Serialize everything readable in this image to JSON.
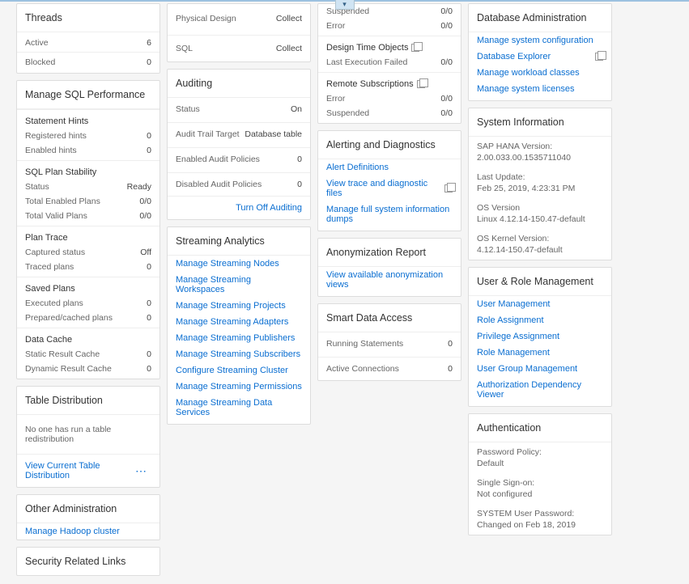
{
  "threads": {
    "title": "Threads",
    "active_l": "Active",
    "active_v": "6",
    "blocked_l": "Blocked",
    "blocked_v": "0"
  },
  "sqlperf": {
    "title": "Manage SQL Performance",
    "hints_title": "Statement Hints",
    "reghints_l": "Registered hints",
    "reghints_v": "0",
    "enabhints_l": "Enabled hints",
    "enabhints_v": "0",
    "plan_title": "SQL Plan Stability",
    "status_l": "Status",
    "status_v": "Ready",
    "enabplans_l": "Total Enabled Plans",
    "enabplans_v": "0/0",
    "validplans_l": "Total Valid Plans",
    "validplans_v": "0/0",
    "trace_title": "Plan Trace",
    "captured_l": "Captured status",
    "captured_v": "Off",
    "traced_l": "Traced plans",
    "traced_v": "0",
    "saved_title": "Saved Plans",
    "exec_l": "Executed plans",
    "exec_v": "0",
    "prep_l": "Prepared/cached plans",
    "prep_v": "0",
    "cache_title": "Data Cache",
    "static_l": "Static Result Cache",
    "static_v": "0",
    "dyn_l": "Dynamic Result Cache",
    "dyn_v": "0"
  },
  "tabledist": {
    "title": "Table Distribution",
    "msg": "No one has run a table redistribution",
    "link": "View Current Table Distribution"
  },
  "otheradmin": {
    "title": "Other Administration",
    "hadoop": "Manage Hadoop cluster"
  },
  "secrel": {
    "title": "Security Related Links"
  },
  "phys": {
    "physical_l": "Physical Design",
    "physical_v": "Collect",
    "sql_l": "SQL",
    "sql_v": "Collect"
  },
  "auditing": {
    "title": "Auditing",
    "status_l": "Status",
    "status_v": "On",
    "trail_l": "Audit Trail Target",
    "trail_v": "Database table",
    "enabled_l": "Enabled Audit Policies",
    "enabled_v": "0",
    "disabled_l": "Disabled Audit Policies",
    "disabled_v": "0",
    "turnoff": "Turn Off Auditing"
  },
  "streaming": {
    "title": "Streaming Analytics",
    "l1": "Manage Streaming Nodes",
    "l2": "Manage Streaming Workspaces",
    "l3": "Manage Streaming Projects",
    "l4": "Manage Streaming Adapters",
    "l5": "Manage Streaming Publishers",
    "l6": "Manage Streaming Subscribers",
    "l7": "Configure Streaming Cluster",
    "l8": "Manage Streaming Permissions",
    "l9": "Manage Streaming Data Services"
  },
  "col3top": {
    "susp_l": "Suspended",
    "susp_v": "0/0",
    "error_l": "Error",
    "error_v": "0/0",
    "dto_l": "Design Time Objects",
    "lef_l": "Last Execution Failed",
    "lef_v": "0/0",
    "rs_l": "Remote Subscriptions",
    "rs_err_l": "Error",
    "rs_err_v": "0/0",
    "rs_susp_l": "Suspended",
    "rs_susp_v": "0/0"
  },
  "alerting": {
    "title": "Alerting and Diagnostics",
    "l1": "Alert Definitions",
    "l2": "View trace and diagnostic files",
    "l3": "Manage full system information dumps"
  },
  "anon": {
    "title": "Anonymization Report",
    "l1": "View available anonymization views"
  },
  "sda": {
    "title": "Smart Data Access",
    "run_l": "Running Statements",
    "run_v": "0",
    "act_l": "Active Connections",
    "act_v": "0"
  },
  "dbadmin": {
    "title": "Database Administration",
    "l1": "Manage system configuration",
    "l2": "Database Explorer",
    "l3": "Manage workload classes",
    "l4": "Manage system licenses"
  },
  "sysinfo": {
    "title": "System Information",
    "hana_l": "SAP HANA Version:",
    "hana_v": "2.00.033.00.1535711040",
    "upd_l": "Last Update:",
    "upd_v": "Feb 25, 2019, 4:23:31 PM",
    "os_l": "OS Version",
    "os_v": "Linux 4.12.14-150.47-default",
    "kern_l": "OS Kernel Version:",
    "kern_v": "4.12.14-150.47-default"
  },
  "userrole": {
    "title": "User & Role Management",
    "l1": "User Management",
    "l2": "Role Assignment",
    "l3": "Privilege Assignment",
    "l4": "Role Management",
    "l5": "User Group Management",
    "l6": "Authorization Dependency Viewer"
  },
  "auth": {
    "title": "Authentication",
    "pw_l": "Password Policy:",
    "pw_v": "Default",
    "sso_l": "Single Sign-on:",
    "sso_v": "Not configured",
    "sys_l": "SYSTEM User Password:",
    "sys_v": "Changed on Feb 18, 2019"
  }
}
